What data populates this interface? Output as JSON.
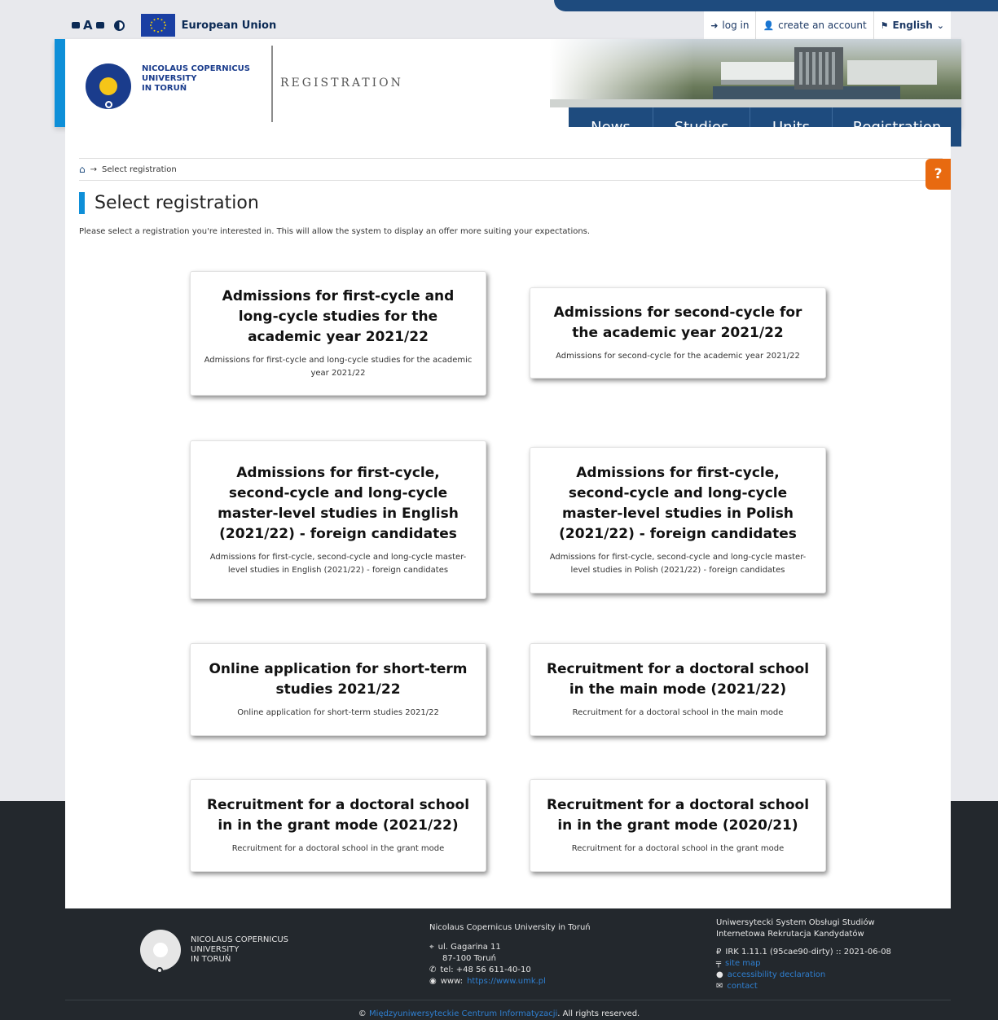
{
  "topbar": {
    "eu_label": "European Union",
    "login": "log in",
    "create_account": "create an account",
    "language": "English"
  },
  "header": {
    "university_name_line1": "NICOLAUS COPERNICUS",
    "university_name_line2": "UNIVERSITY",
    "university_name_line3": "IN TORUŃ",
    "section_label": "REGISTRATION"
  },
  "nav": {
    "items": [
      {
        "label": "News"
      },
      {
        "label": "Studies"
      },
      {
        "label": "Units"
      },
      {
        "label": "Registration"
      }
    ]
  },
  "help_label": "?",
  "breadcrumb": {
    "arrow": "→",
    "current": "Select registration"
  },
  "page": {
    "title": "Select registration",
    "intro": "Please select a registration you're interested in. This will allow the system to display an offer more suiting your expectations."
  },
  "cards": [
    {
      "title": "Admissions for first-cycle and long-cycle studies for the academic year 2021/22",
      "description": "Admissions for first-cycle and long-cycle studies for the academic year 2021/22"
    },
    {
      "title": "Admissions for second-cycle for the academic year 2021/22",
      "description": "Admissions for second-cycle for the academic year 2021/22"
    },
    {
      "title": "Admissions for first-cycle, second-cycle and long-cycle master-level studies in English (2021/22) - foreign candidates",
      "description": "Admissions for first-cycle, second-cycle and long-cycle master-level studies in English (2021/22) - foreign candidates"
    },
    {
      "title": "Admissions for first-cycle, second-cycle and long-cycle master-level studies in Polish (2021/22) - foreign candidates",
      "description": "Admissions for first-cycle, second-cycle and long-cycle master-level studies in Polish (2021/22) - foreign candidates"
    },
    {
      "title": "Online application for short-term studies 2021/22",
      "description": "Online application for short-term studies 2021/22"
    },
    {
      "title": "Recruitment for a doctoral school in the main mode (2021/22)",
      "description": "Recruitment for a doctoral school in the main mode"
    },
    {
      "title": "Recruitment for a doctoral school in in the grant mode (2021/22)",
      "description": "Recruitment for a doctoral school in the grant mode"
    },
    {
      "title": "Recruitment for a doctoral school in in the grant mode (2020/21)",
      "description": "Recruitment for a doctoral school in the grant mode"
    }
  ],
  "footer": {
    "uni_line1": "NICOLAUS COPERNICUS",
    "uni_line2": "UNIVERSITY",
    "uni_line3": "IN TORUŃ",
    "address_title": "Nicolaus Copernicus University in Toruń",
    "street": "ul. Gagarina 11",
    "city": "87-100 Toruń",
    "phone": "tel: +48 56 611-40-10",
    "www_label": "www:",
    "www_link": "https://www.umk.pl",
    "system_line1": "Uniwersytecki System Obsługi Studiów",
    "system_line2": "Internetowa Rekrutacja Kandydatów",
    "version": "IRK 1.11.1 (95cae90-dirty) :: 2021-06-08",
    "site_map": "site map",
    "accessibility": "accessibility declaration",
    "contact": "contact",
    "copyright_link": "Międzyuniwersyteckie Centrum Informatyzacji",
    "copyright_suffix": ". All rights reserved."
  },
  "colors": {
    "nav_blue": "#1e4b7e",
    "accent_cyan": "#0e8fd8",
    "help_orange": "#e86a10",
    "footer_dark": "#23282d",
    "link_blue": "#2f7fd0"
  },
  "icons": {
    "home": "home-icon",
    "login": "sign-in-icon",
    "create_account": "user-plus-icon",
    "language": "language-icon",
    "location": "map-marker-icon",
    "phone": "phone-icon",
    "web": "globe-icon",
    "version": "code-icon",
    "site_map": "sitemap-icon",
    "accessibility": "info-icon",
    "contact": "envelope-icon",
    "copyright": "copyright-icon"
  }
}
